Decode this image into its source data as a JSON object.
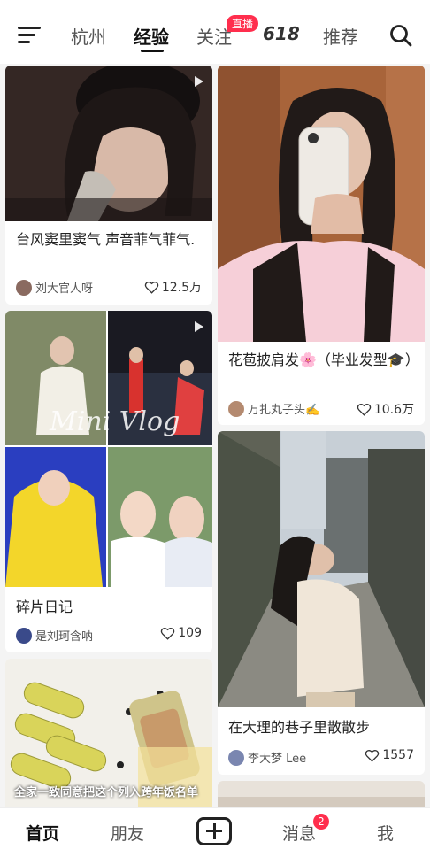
{
  "nav": {
    "tabs": [
      "杭州",
      "经验",
      "关注",
      "618",
      "推荐"
    ],
    "live_badge": "直播"
  },
  "feed": {
    "left": [
      {
        "title": "台风窦里窦气 声音菲气菲气.",
        "author": "刘大官人呀",
        "likes": "12.5万"
      },
      {
        "title": "碎片日记",
        "author": "是刘珂含呐",
        "likes": "109",
        "overlay_text": "Mini Vlog"
      },
      {
        "caption": "全家一致同意把这个列入跨年饭名单"
      }
    ],
    "right": [
      {
        "title": "花苞披肩发🌸（毕业发型🎓）",
        "author": "万扎丸子头✍️",
        "likes": "10.6万"
      },
      {
        "title": "在大理的巷子里散散步",
        "author": "李大梦 Lee",
        "likes": "1557"
      }
    ]
  },
  "bottom": {
    "home": "首页",
    "friends": "朋友",
    "messages": "消息",
    "messages_badge": "2",
    "me": "我"
  }
}
